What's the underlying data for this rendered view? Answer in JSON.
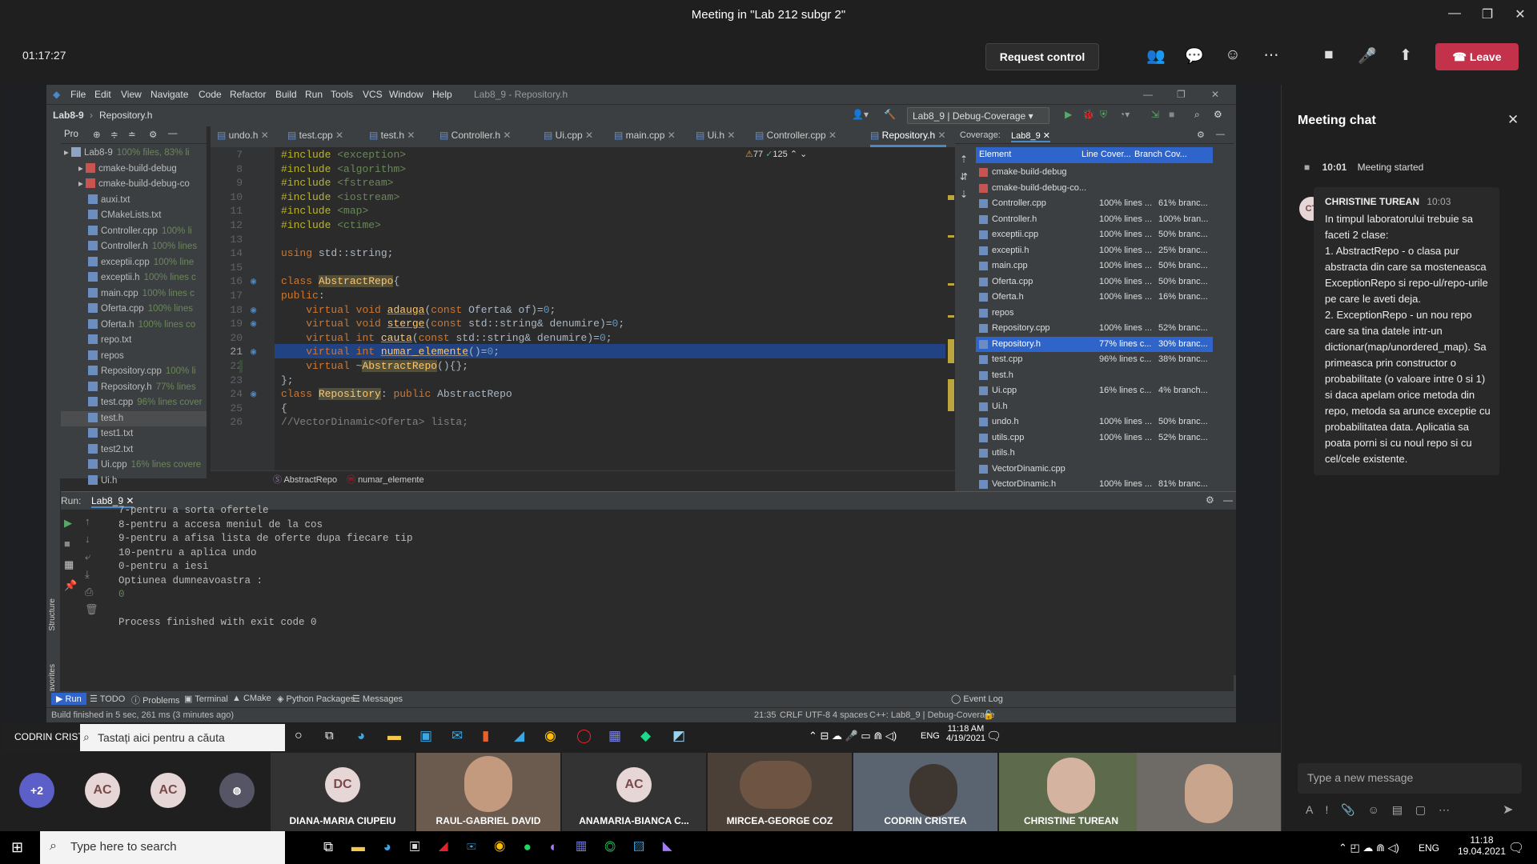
{
  "teams": {
    "meeting_title": "Meeting in \"Lab 212 subgr 2\"",
    "timer": "01:17:27",
    "request_control": "Request control",
    "leave": "Leave"
  },
  "ide": {
    "window_title": "Lab8_9 - Repository.h",
    "menu": [
      "File",
      "Edit",
      "View",
      "Navigate",
      "Code",
      "Refactor",
      "Build",
      "Run",
      "Tools",
      "VCS",
      "Window",
      "Help"
    ],
    "nav": {
      "project": "Lab8-9",
      "file": "Repository.h",
      "config": "Lab8_9 | Debug-Coverage"
    },
    "project_tool": "Pro",
    "tree": [
      {
        "name": "Lab8-9",
        "cov": "100% files, 83% li",
        "type": "folder"
      },
      {
        "name": "cmake-build-debug",
        "cov": "",
        "type": "folder"
      },
      {
        "name": "cmake-build-debug-co",
        "cov": "",
        "type": "folder"
      },
      {
        "name": "auxi.txt",
        "cov": "",
        "type": "file"
      },
      {
        "name": "CMakeLists.txt",
        "cov": "",
        "type": "file"
      },
      {
        "name": "Controller.cpp",
        "cov": "100% li",
        "type": "file"
      },
      {
        "name": "Controller.h",
        "cov": "100% lines",
        "type": "file"
      },
      {
        "name": "exceptii.cpp",
        "cov": "100% line",
        "type": "file"
      },
      {
        "name": "exceptii.h",
        "cov": "100% lines c",
        "type": "file"
      },
      {
        "name": "main.cpp",
        "cov": "100% lines c",
        "type": "file"
      },
      {
        "name": "Oferta.cpp",
        "cov": "100% lines",
        "type": "file"
      },
      {
        "name": "Oferta.h",
        "cov": "100% lines co",
        "type": "file"
      },
      {
        "name": "repo.txt",
        "cov": "",
        "type": "file"
      },
      {
        "name": "repos",
        "cov": "",
        "type": "file"
      },
      {
        "name": "Repository.cpp",
        "cov": "100% li",
        "type": "file"
      },
      {
        "name": "Repository.h",
        "cov": "77% lines",
        "type": "file"
      },
      {
        "name": "test.cpp",
        "cov": "96% lines cover",
        "type": "file"
      },
      {
        "name": "test.h",
        "cov": "",
        "type": "file"
      },
      {
        "name": "test1.txt",
        "cov": "",
        "type": "file"
      },
      {
        "name": "test2.txt",
        "cov": "",
        "type": "file"
      },
      {
        "name": "Ui.cpp",
        "cov": "16% lines covere",
        "type": "file"
      },
      {
        "name": "Ui.h",
        "cov": "",
        "type": "file"
      }
    ],
    "tabs": [
      "undo.h",
      "test.cpp",
      "test.h",
      "Controller.h",
      "Ui.cpp",
      "main.cpp",
      "Ui.h",
      "Controller.cpp",
      "Repository.h",
      "Reposi"
    ],
    "inspections": {
      "warnings": "77",
      "ok": "125"
    },
    "code_lines": [
      {
        "n": "7",
        "t": "#include <exception>"
      },
      {
        "n": "8",
        "t": "#include <algorithm>"
      },
      {
        "n": "9",
        "t": "#include <fstream>"
      },
      {
        "n": "10",
        "t": "#include <iostream>"
      },
      {
        "n": "11",
        "t": "#include <map>"
      },
      {
        "n": "12",
        "t": "#include <ctime>"
      },
      {
        "n": "13",
        "t": ""
      },
      {
        "n": "14",
        "t": "using std::string;"
      },
      {
        "n": "15",
        "t": ""
      },
      {
        "n": "16",
        "t": "class AbstractRepo{"
      },
      {
        "n": "17",
        "t": "public:"
      },
      {
        "n": "18",
        "t": "    virtual void adauga(const Oferta& of)=0;"
      },
      {
        "n": "19",
        "t": "    virtual void sterge(const std::string& denumire)=0;"
      },
      {
        "n": "20",
        "t": "    virtual int cauta(const std::string& denumire)=0;"
      },
      {
        "n": "21",
        "t": "    virtual int numar_elemente()=0;"
      },
      {
        "n": "22",
        "t": "    virtual ~AbstractRepo(){};"
      },
      {
        "n": "23",
        "t": "};"
      },
      {
        "n": "24",
        "t": "class Repository: public AbstractRepo"
      },
      {
        "n": "25",
        "t": "{"
      },
      {
        "n": "26",
        "t": "//VectorDinamic<Oferta> lista;"
      }
    ],
    "breadcrumb": [
      "AbstractRepo",
      "numar_elemente"
    ],
    "coverage": {
      "label": "Coverage:",
      "tab": "Lab8_9",
      "headers": [
        "Element",
        "Line Cover...",
        "Branch Cov..."
      ],
      "rows": [
        {
          "e": "cmake-build-debug",
          "l": "",
          "b": "",
          "folder": true
        },
        {
          "e": "cmake-build-debug-co...",
          "l": "",
          "b": "",
          "folder": true
        },
        {
          "e": "Controller.cpp",
          "l": "100% lines ...",
          "b": "61% branc..."
        },
        {
          "e": "Controller.h",
          "l": "100% lines ...",
          "b": "100% bran..."
        },
        {
          "e": "exceptii.cpp",
          "l": "100% lines ...",
          "b": "50% branc..."
        },
        {
          "e": "exceptii.h",
          "l": "100% lines ...",
          "b": "25% branc..."
        },
        {
          "e": "main.cpp",
          "l": "100% lines ...",
          "b": "50% branc..."
        },
        {
          "e": "Oferta.cpp",
          "l": "100% lines ...",
          "b": "50% branc..."
        },
        {
          "e": "Oferta.h",
          "l": "100% lines ...",
          "b": "16% branc..."
        },
        {
          "e": "repos",
          "l": "",
          "b": ""
        },
        {
          "e": "Repository.cpp",
          "l": "100% lines ...",
          "b": "52% branc..."
        },
        {
          "e": "Repository.h",
          "l": "77% lines c...",
          "b": "30% branc...",
          "sel": true
        },
        {
          "e": "test.cpp",
          "l": "96% lines c...",
          "b": "38% branc..."
        },
        {
          "e": "test.h",
          "l": "",
          "b": ""
        },
        {
          "e": "Ui.cpp",
          "l": "16% lines c...",
          "b": "4% branch..."
        },
        {
          "e": "Ui.h",
          "l": "",
          "b": ""
        },
        {
          "e": "undo.h",
          "l": "100% lines ...",
          "b": "50% branc..."
        },
        {
          "e": "utils.cpp",
          "l": "100% lines ...",
          "b": "52% branc..."
        },
        {
          "e": "utils.h",
          "l": "",
          "b": ""
        },
        {
          "e": "VectorDinamic.cpp",
          "l": "",
          "b": ""
        },
        {
          "e": "VectorDinamic.h",
          "l": "100% lines ...",
          "b": "81% branc..."
        }
      ]
    },
    "run": {
      "label": "Run:",
      "tab": "Lab8_9",
      "console": [
        "7-pentru a sorta ofertele",
        "8-pentru a accesa meniul de la cos",
        "9-pentru a afisa lista de oferte dupa fiecare tip",
        "10-pentru a aplica undo",
        "0-pentru a iesi",
        "Optiunea dumneavoastra :",
        "0",
        "",
        "Process finished with exit code 0"
      ]
    },
    "tool_windows": [
      "Run",
      "TODO",
      "Problems",
      "Terminal",
      "CMake",
      "Python Packages",
      "Messages",
      "Event Log"
    ],
    "status": {
      "build": "Build finished in 5 sec, 261 ms (3 minutes ago)",
      "pos": "21:35",
      "eol": "CRLF",
      "enc": "UTF-8",
      "indent": "4 spaces",
      "ctx": "C++: Lab8_9 | Debug-Coverage"
    }
  },
  "inner_taskbar": {
    "presenter": "CODRIN CRISTEA",
    "search": "Tastați aici pentru a căuta",
    "lang": "ENG",
    "time": "11:18 AM",
    "date": "4/19/2021"
  },
  "participants": [
    {
      "name": "",
      "initials": "+2"
    },
    {
      "name": "",
      "initials": "AC"
    },
    {
      "name": "",
      "initials": "AC"
    },
    {
      "name": "DIANA-MARIA CIUPEIU",
      "initials": "DC"
    },
    {
      "name": "RAUL-GABRIEL DAVID",
      "initials": ""
    },
    {
      "name": "ANAMARIA-BIANCA C...",
      "initials": "AC"
    },
    {
      "name": "MIRCEA-GEORGE COZ",
      "initials": ""
    },
    {
      "name": "CODRIN CRISTEA",
      "initials": ""
    },
    {
      "name": "CHRISTINE TUREAN",
      "initials": ""
    },
    {
      "name": "",
      "initials": ""
    }
  ],
  "chat": {
    "title": "Meeting chat",
    "system_time": "10:01",
    "system_text": "Meeting started",
    "sender": "CHRISTINE TUREAN",
    "sender_initials": "CT",
    "time": "10:03",
    "message": [
      "In timpul laboratorului trebuie sa faceti 2 clase:",
      "1. AbstractRepo - o clasa pur abstracta din care sa mosteneasca ExceptionRepo si repo-ul/repo-urile pe care le aveti deja.",
      "2. ExceptionRepo - un nou repo care sa tina datele intr-un dictionar(map/unordered_map). Sa primeasca prin constructor o probabilitate (o valoare intre 0 si 1) si daca apelam orice metoda din repo, metoda sa arunce exceptie cu probabilitatea data. Aplicatia sa poata porni si cu noul repo si cu cel/cele existente."
    ],
    "input_placeholder": "Type a new message"
  },
  "win_taskbar": {
    "search": "Type here to search",
    "lang": "ENG",
    "time": "11:18",
    "date": "19.04.2021"
  }
}
